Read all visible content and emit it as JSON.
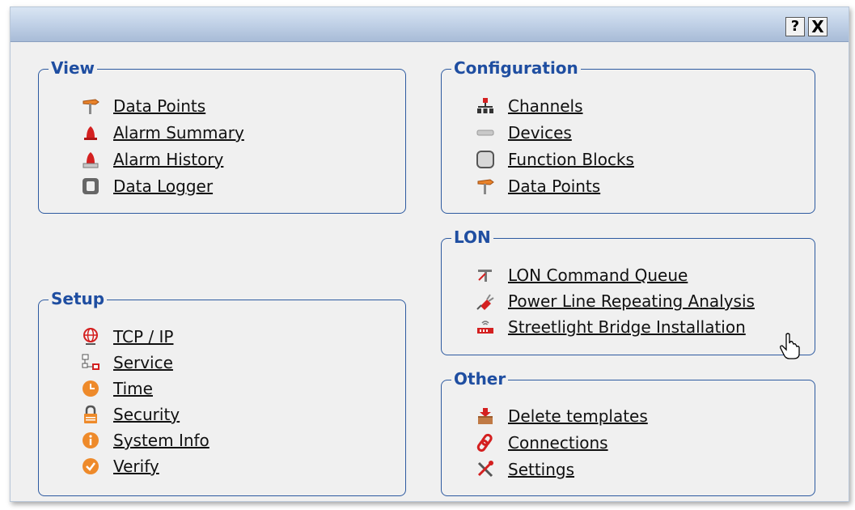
{
  "titlebar": {
    "help_label": "?",
    "close_label": "X"
  },
  "view": {
    "title": "View",
    "items": [
      {
        "label": "Data Points",
        "icon": "data-point-signpost-icon"
      },
      {
        "label": "Alarm Summary",
        "icon": "alarm-bell-icon"
      },
      {
        "label": "Alarm History",
        "icon": "alarm-history-icon"
      },
      {
        "label": "Data Logger",
        "icon": "data-logger-icon"
      }
    ]
  },
  "configuration": {
    "title": "Configuration",
    "items": [
      {
        "label": "Channels",
        "icon": "network-channels-icon"
      },
      {
        "label": "Devices",
        "icon": "device-icon"
      },
      {
        "label": "Function Blocks",
        "icon": "function-block-icon"
      },
      {
        "label": "Data Points",
        "icon": "data-point-signpost-icon"
      }
    ]
  },
  "lon": {
    "title": "LON",
    "items": [
      {
        "label": "LON Command Queue",
        "icon": "command-queue-icon"
      },
      {
        "label": "Power Line Repeating Analysis",
        "icon": "power-plug-icon"
      },
      {
        "label": "Streetlight Bridge Installation",
        "icon": "wireless-bridge-icon"
      }
    ]
  },
  "setup": {
    "title": "Setup",
    "items": [
      {
        "label": "TCP / IP",
        "icon": "globe-icon"
      },
      {
        "label": "Service",
        "icon": "service-network-icon"
      },
      {
        "label": "Time",
        "icon": "clock-icon"
      },
      {
        "label": "Security",
        "icon": "lock-icon"
      },
      {
        "label": "System Info",
        "icon": "info-icon"
      },
      {
        "label": "Verify",
        "icon": "checkmark-icon"
      }
    ]
  },
  "other": {
    "title": "Other",
    "items": [
      {
        "label": "Delete templates",
        "icon": "delete-template-icon"
      },
      {
        "label": "Connections",
        "icon": "chain-link-icon"
      },
      {
        "label": "Settings",
        "icon": "tools-icon"
      }
    ]
  },
  "colors": {
    "group_title": "#1f4ea1",
    "group_border": "#2d5aa0",
    "background": "#f0f0f0"
  }
}
